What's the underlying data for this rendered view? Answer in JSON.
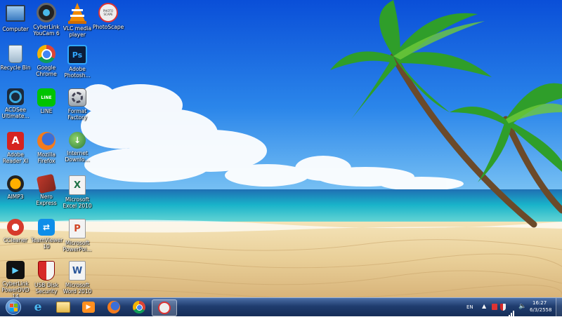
{
  "desktop": {
    "icons": [
      {
        "label": "Computer"
      },
      {
        "label": "CyberLink\nYouCam 6"
      },
      {
        "label": "VLC media\nplayer"
      },
      {
        "label": "PhotoScape"
      },
      {
        "label": "Recycle Bin"
      },
      {
        "label": "Google\nChrome"
      },
      {
        "label": "Adobe\nPhotosh..."
      },
      {
        "label": "ACDSee\nUltimate..."
      },
      {
        "label": "LINE"
      },
      {
        "label": "Format\nFactory"
      },
      {
        "label": "Adobe\nReader XI"
      },
      {
        "label": "Mozilla\nFirefox"
      },
      {
        "label": "Internet\nDownlo..."
      },
      {
        "label": "AIMP3"
      },
      {
        "label": "Nero Express"
      },
      {
        "label": "Microsoft\nExcel 2010"
      },
      {
        "label": "CCleaner"
      },
      {
        "label": "TeamViewer\n10"
      },
      {
        "label": "Microsoft\nPowerPoi..."
      },
      {
        "label": "CyberLink\nPowerDVD 14"
      },
      {
        "label": "USB Disk\nSecurity"
      },
      {
        "label": "Microsoft\nWord 2010"
      }
    ],
    "icon_glyphs": {
      "photoscape_badge": "PHOTO SCAPE",
      "photoshop": "Ps",
      "line": "LINE",
      "excel": "X",
      "powerpoint": "P",
      "word": "W"
    }
  },
  "taskbar": {
    "language": "EN",
    "clock_time": "16:27",
    "clock_date": "6/3/2558",
    "pinned": [
      "start-orb",
      "internet-explorer",
      "file-explorer",
      "media-player",
      "firefox",
      "chrome",
      "photoscape"
    ]
  },
  "colors": {
    "sky_top": "#0a4fd8",
    "sea": "#19b3c9",
    "sand": "#e9cf98",
    "taskbar": "#1f3c6e"
  }
}
